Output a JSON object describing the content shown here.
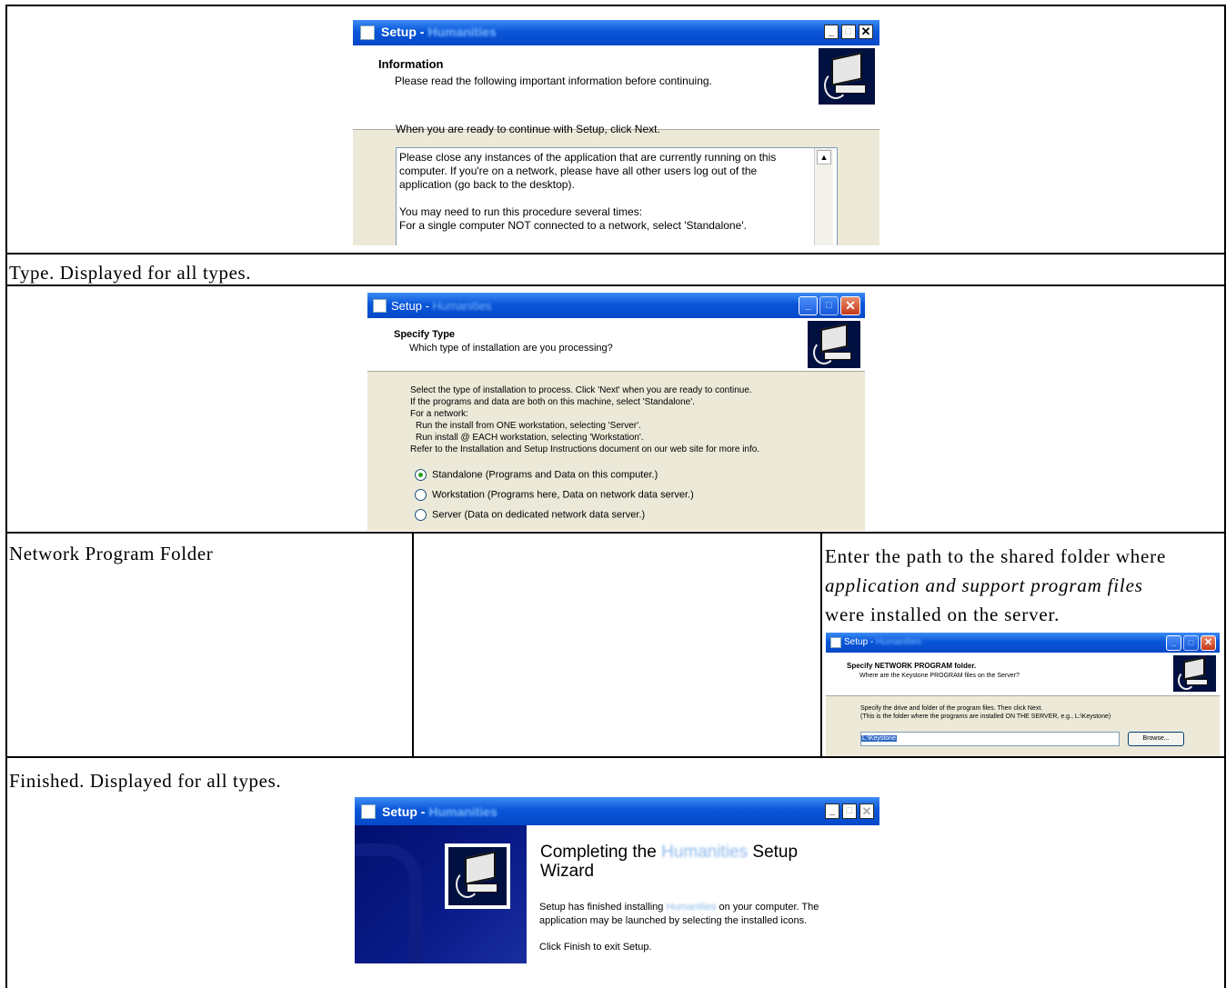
{
  "rows": {
    "type_caption": "Type. Displayed for all types.",
    "network_label": "Network Program Folder",
    "network_desc": {
      "line1": "Enter the path to the shared folder where",
      "line2": "application and support program files",
      "line3": "were installed on the server."
    },
    "finished_caption": "Finished. Displayed for all types."
  },
  "window_info": {
    "title": "Setup - ",
    "title_app": "Humanities",
    "header_title": "Information",
    "header_sub": "Please read the following important information before continuing.",
    "prompt": "When you are ready to continue with Setup, click Next.",
    "memo_lines": [
      "Please close any instances of the application that are currently running on this",
      "computer. If you're on a network, please have all other users log out of the",
      "application (go back to the desktop).",
      "",
      "You may need to run this procedure several times:",
      "For a single computer NOT connected to a network, select 'Standalone'."
    ]
  },
  "window_type": {
    "title": "Setup - ",
    "title_app": "Humanities",
    "header_title": "Specify Type",
    "header_sub": "Which type of installation are you processing?",
    "instructions": [
      "Select the type of installation to process. Click 'Next' when you are ready to continue.",
      "If the programs and data are both on this machine, select 'Standalone'.",
      "For a network:",
      "  Run the install from ONE workstation, selecting 'Server'.",
      "  Run install @ EACH workstation, selecting 'Workstation'.",
      "Refer to the Installation and Setup Instructions document on our web site for more info."
    ],
    "options": [
      {
        "label": "Standalone (Programs and Data on this computer.)",
        "selected": true
      },
      {
        "label": "Workstation (Programs here, Data on network data server.)",
        "selected": false
      },
      {
        "label": "Server (Data on dedicated network data server.)",
        "selected": false
      }
    ]
  },
  "window_network": {
    "title": "Setup - ",
    "title_app": "Humanities",
    "header_title": "Specify NETWORK PROGRAM folder.",
    "header_sub": "Where are the Keystone PROGRAM files on the Server?",
    "line1": "Specify the drive and folder of the program files. Then click Next.",
    "line2": "(This is the folder where the programs are installed ON THE SERVER, e.g., L:\\Keystone)",
    "path_value": "L:\\Keystone",
    "browse_label": "Browse..."
  },
  "window_finish": {
    "title": "Setup - ",
    "title_app": "Humanities",
    "heading_pre": "Completing the ",
    "heading_app": "Humanities",
    "heading_post": " Setup",
    "heading_line2": "Wizard",
    "msg_pre": "Setup has finished installing ",
    "msg_app": "Humanities",
    "msg_post": " on your computer. The",
    "msg_line2": "application may be launched by selecting the installed icons.",
    "exit_msg": "Click Finish to exit Setup."
  },
  "colors": {
    "titlebar": "#0a56d9",
    "dialog_bg": "#ece9d8",
    "finish_sidebar": "#000f6e"
  }
}
